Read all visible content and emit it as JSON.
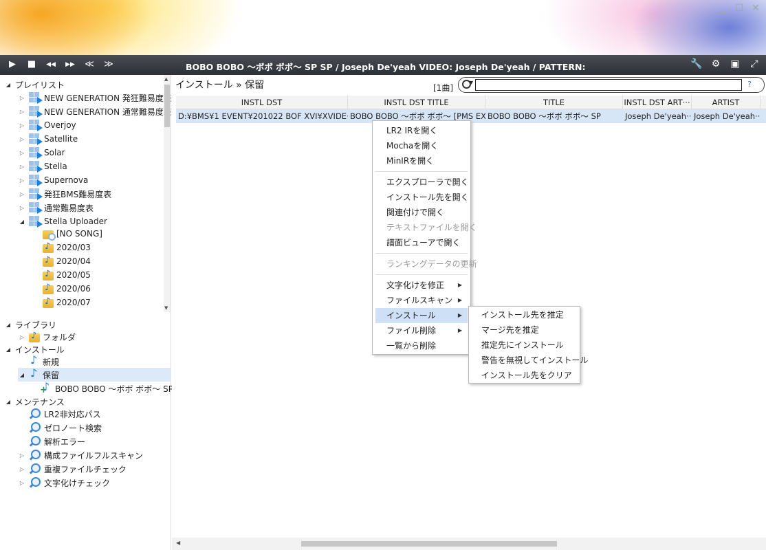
{
  "window": {
    "min": "▁",
    "max": "☐",
    "close": "✕"
  },
  "toolbar": {
    "play": "▶",
    "stop": "■",
    "rewind": "◀◀",
    "forward": "▶▶",
    "prev": "≪",
    "next": "≫",
    "now_playing": "BOBO BOBO ～ボボ ボボ～ SP  SP  / Joseph De'yeah VIDEO: Joseph De'yeah / PATTERN:",
    "tools": "🔧",
    "settings": "⚙",
    "image": "▣",
    "expand": "⤢"
  },
  "tree": {
    "playlist": {
      "label": "プレイリスト",
      "items": [
        "NEW GENERATION 発狂難易度表",
        "NEW GENERATION 通常難易度表",
        "Overjoy",
        "Satellite",
        "Solar",
        "Stella",
        "Supernova",
        "発狂BMS難易度表",
        "通常難易度表",
        "Stella Uploader"
      ],
      "children": [
        "[NO SONG]",
        "2020/03",
        "2020/04",
        "2020/05",
        "2020/06",
        "2020/07"
      ]
    },
    "library": {
      "label": "ライブラリ",
      "folder": "フォルダ"
    },
    "install": {
      "label": "インストール",
      "new": "新規",
      "hold": "保留",
      "hold_child": "BOBO BOBO ～ボボ ボボ～ SP"
    },
    "maintenance": {
      "label": "メンテナンス",
      "items": [
        "LR2非対応パス",
        "ゼロノート検索",
        "解析エラー",
        "構成ファイルフルスキャン",
        "重複ファイルチェック",
        "文字化けチェック"
      ]
    }
  },
  "main": {
    "breadcrumb": "インストール » 保留",
    "count": "[1曲]",
    "search": {
      "value": "",
      "help": "?"
    },
    "columns": [
      "INSTL DST",
      "INSTL DST TITLE",
      "TITLE",
      "INSTL DST ART···",
      "ARTIST"
    ],
    "row": [
      "D:¥BMS¥1 EVENT¥201022 BOF XVI¥XVIDE···",
      "BOBO BOBO ～ボボ ボボ～ [PMS EX]",
      "BOBO BOBO ～ボボ ボボ～ SP",
      "Joseph De'yeah···",
      "Joseph De'yeah···"
    ]
  },
  "context_menu": {
    "items": [
      "LR2 IRを開く",
      "Mochaを開く",
      "MinIRを開く",
      "エクスプローラで開く",
      "インストール先を開く",
      "関連付けで開く",
      "テキストファイルを開く",
      "譜面ビューアで開く",
      "ランキングデータの更新",
      "文字化けを修正",
      "ファイルスキャン",
      "インストール",
      "ファイル削除",
      "一覧から削除"
    ],
    "submenu_arrow": "▶"
  },
  "submenu": {
    "items": [
      "インストール先を推定",
      "マージ先を推定",
      "推定先にインストール",
      "警告を無視してインストール",
      "インストール先をクリア"
    ]
  }
}
